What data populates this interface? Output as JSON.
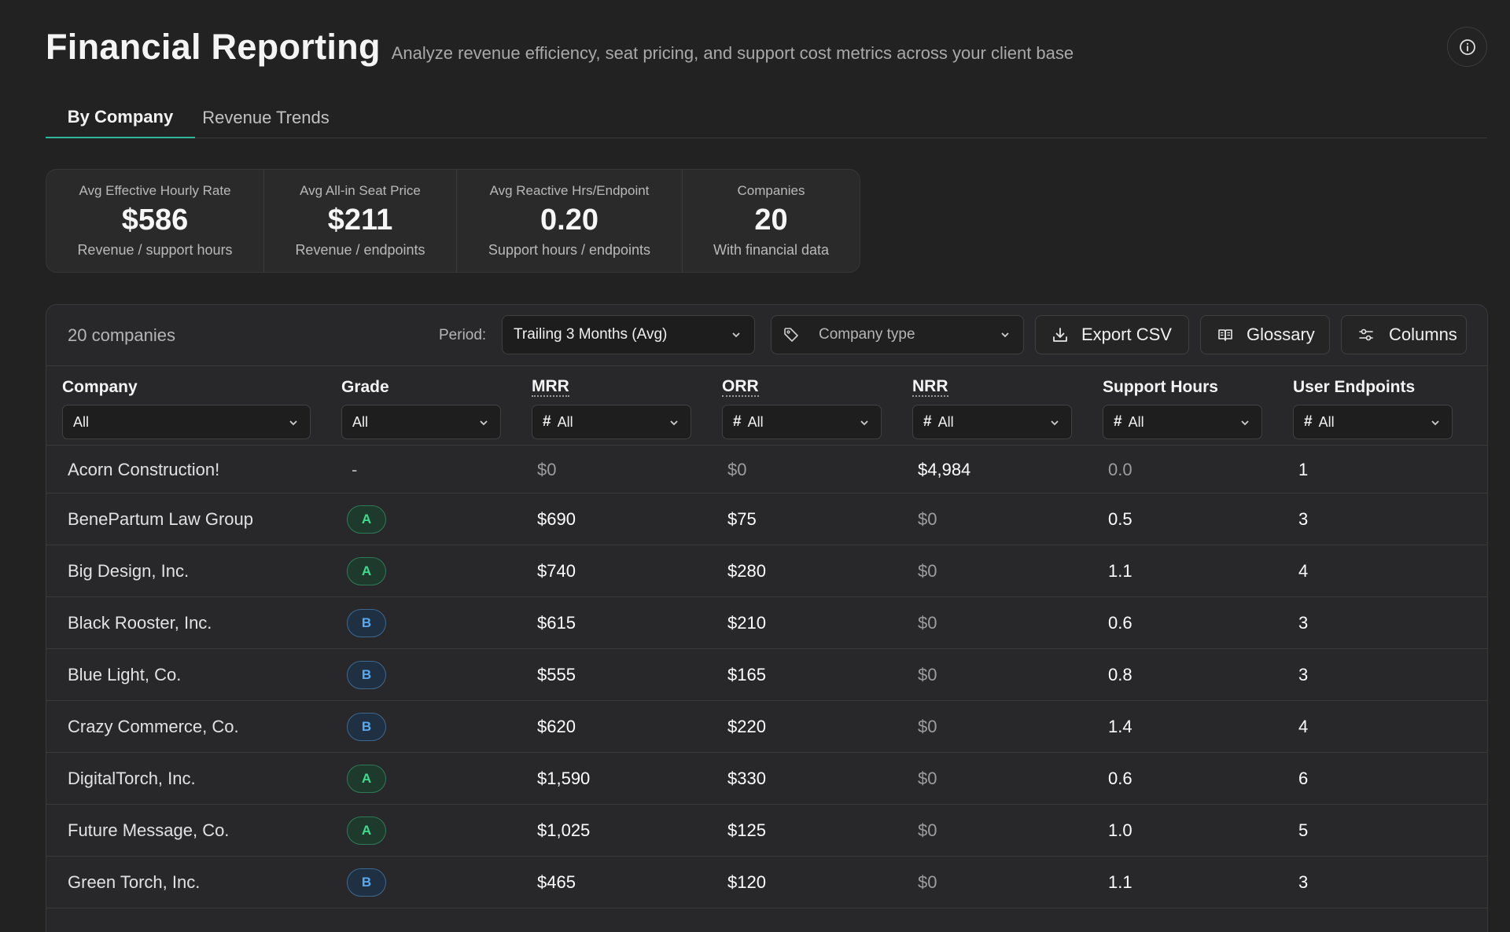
{
  "header": {
    "title": "Financial Reporting",
    "subtitle": "Analyze revenue efficiency, seat pricing, and support cost metrics across your client base"
  },
  "tabs": [
    {
      "label": "By Company",
      "active": true
    },
    {
      "label": "Revenue Trends",
      "active": false
    }
  ],
  "stats": [
    {
      "label": "Avg Effective Hourly Rate",
      "value": "$586",
      "sub": "Revenue / support hours"
    },
    {
      "label": "Avg All-in Seat Price",
      "value": "$211",
      "sub": "Revenue / endpoints"
    },
    {
      "label": "Avg Reactive Hrs/Endpoint",
      "value": "0.20",
      "sub": "Support hours / endpoints"
    },
    {
      "label": "Companies",
      "value": "20",
      "sub": "With financial data"
    }
  ],
  "toolbar": {
    "count": "20 companies",
    "period_label": "Period:",
    "period_value": "Trailing 3 Months (Avg)",
    "company_type_placeholder": "Company type",
    "export_label": "Export CSV",
    "glossary_label": "Glossary",
    "columns_label": "Columns"
  },
  "columns": {
    "company": {
      "label": "Company",
      "filter": "All"
    },
    "grade": {
      "label": "Grade",
      "filter": "All"
    },
    "mrr": {
      "label": "MRR",
      "filter": "All"
    },
    "orr": {
      "label": "ORR",
      "filter": "All"
    },
    "nrr": {
      "label": "NRR",
      "filter": "All"
    },
    "hours": {
      "label": "Support Hours",
      "filter": "All"
    },
    "endpoints": {
      "label": "User Endpoints",
      "filter": "All"
    }
  },
  "rows": [
    {
      "company": "Acorn Construction!",
      "grade": "-",
      "mrr": "$0",
      "orr": "$0",
      "nrr": "$4,984",
      "hours": "0.0",
      "endpoints": "1"
    },
    {
      "company": "BenePartum Law Group",
      "grade": "A",
      "mrr": "$690",
      "orr": "$75",
      "nrr": "$0",
      "hours": "0.5",
      "endpoints": "3"
    },
    {
      "company": "Big Design, Inc.",
      "grade": "A",
      "mrr": "$740",
      "orr": "$280",
      "nrr": "$0",
      "hours": "1.1",
      "endpoints": "4"
    },
    {
      "company": "Black Rooster, Inc.",
      "grade": "B",
      "mrr": "$615",
      "orr": "$210",
      "nrr": "$0",
      "hours": "0.6",
      "endpoints": "3"
    },
    {
      "company": "Blue Light, Co.",
      "grade": "B",
      "mrr": "$555",
      "orr": "$165",
      "nrr": "$0",
      "hours": "0.8",
      "endpoints": "3"
    },
    {
      "company": "Crazy Commerce, Co.",
      "grade": "B",
      "mrr": "$620",
      "orr": "$220",
      "nrr": "$0",
      "hours": "1.4",
      "endpoints": "4"
    },
    {
      "company": "DigitalTorch, Inc.",
      "grade": "A",
      "mrr": "$1,590",
      "orr": "$330",
      "nrr": "$0",
      "hours": "0.6",
      "endpoints": "6"
    },
    {
      "company": "Future Message, Co.",
      "grade": "A",
      "mrr": "$1,025",
      "orr": "$125",
      "nrr": "$0",
      "hours": "1.0",
      "endpoints": "5"
    },
    {
      "company": "Green Torch, Inc.",
      "grade": "B",
      "mrr": "$465",
      "orr": "$120",
      "nrr": "$0",
      "hours": "1.1",
      "endpoints": "3"
    }
  ]
}
